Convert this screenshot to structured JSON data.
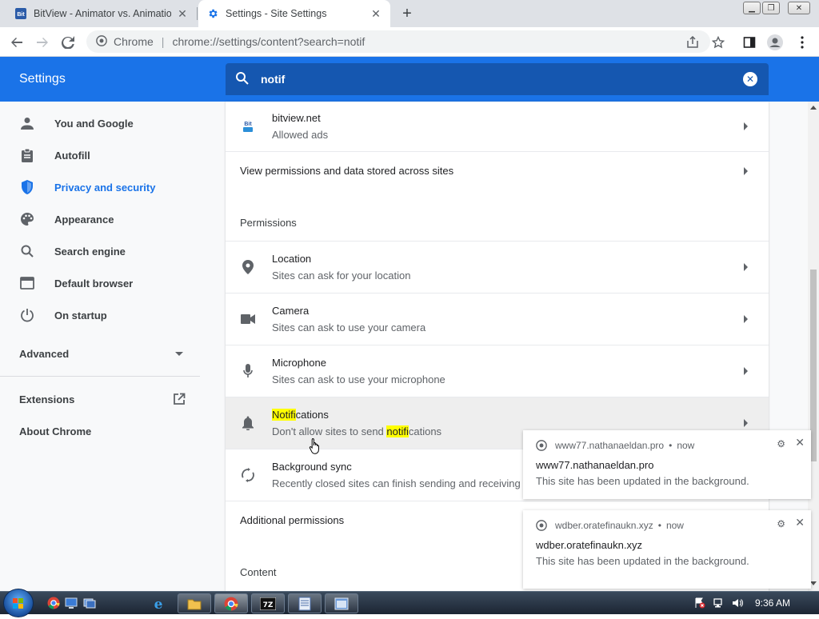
{
  "browser": {
    "tabs": [
      {
        "title": "BitView - Animator vs. Animatio",
        "favicon": "bitview-favicon",
        "active": false
      },
      {
        "title": "Settings - Site Settings",
        "favicon": "gear-icon",
        "active": true
      }
    ],
    "omnibox": {
      "site_label": "Chrome",
      "separator": "|",
      "url": "chrome://settings/content?search=notif"
    }
  },
  "header": {
    "title": "Settings",
    "search_query": "notif"
  },
  "sidebar": {
    "items": [
      {
        "label": "You and Google",
        "icon": "person-icon"
      },
      {
        "label": "Autofill",
        "icon": "clipboard-icon"
      },
      {
        "label": "Privacy and security",
        "icon": "shield-icon",
        "active": true
      },
      {
        "label": "Appearance",
        "icon": "palette-icon"
      },
      {
        "label": "Search engine",
        "icon": "search-icon"
      },
      {
        "label": "Default browser",
        "icon": "browser-icon"
      },
      {
        "label": "On startup",
        "icon": "power-icon"
      }
    ],
    "advanced": "Advanced",
    "extensions": "Extensions",
    "about": "About Chrome"
  },
  "content": {
    "site_row": {
      "title": "bitview.net",
      "subtitle": "Allowed ads"
    },
    "view_permissions": "View permissions and data stored across sites",
    "permissions_heading": "Permissions",
    "permissions": [
      {
        "title": "Location",
        "subtitle": "Sites can ask for your location",
        "icon": "location-pin-icon"
      },
      {
        "title": "Camera",
        "subtitle": "Sites can ask to use your camera",
        "icon": "camera-icon"
      },
      {
        "title": "Microphone",
        "subtitle": "Sites can ask to use your microphone",
        "icon": "microphone-icon"
      }
    ],
    "notifications": {
      "title_hl": "Notifi",
      "title_rest": "cations",
      "sub_pre": "Don't allow sites to send ",
      "sub_hl": "notifi",
      "sub_rest": "cations"
    },
    "background_sync": {
      "title": "Background sync",
      "subtitle": "Recently closed sites can finish sending and receiving"
    },
    "additional_permissions": "Additional permissions",
    "content_heading": "Content"
  },
  "popups": [
    {
      "site": "www77.nathanaeldan.pro",
      "time": "now",
      "origin": "www77.nathanaeldan.pro",
      "message": "This site has been updated in the background."
    },
    {
      "site": "wdber.oratefinaukn.xyz",
      "time": "now",
      "origin": "wdber.oratefinaukn.xyz",
      "message": "This site has been updated in the background."
    }
  ],
  "taskbar": {
    "clock": "9:36 AM"
  },
  "colors": {
    "accent": "#1a73e8",
    "header_search": "#1557b0",
    "highlight": "#ffff00"
  }
}
